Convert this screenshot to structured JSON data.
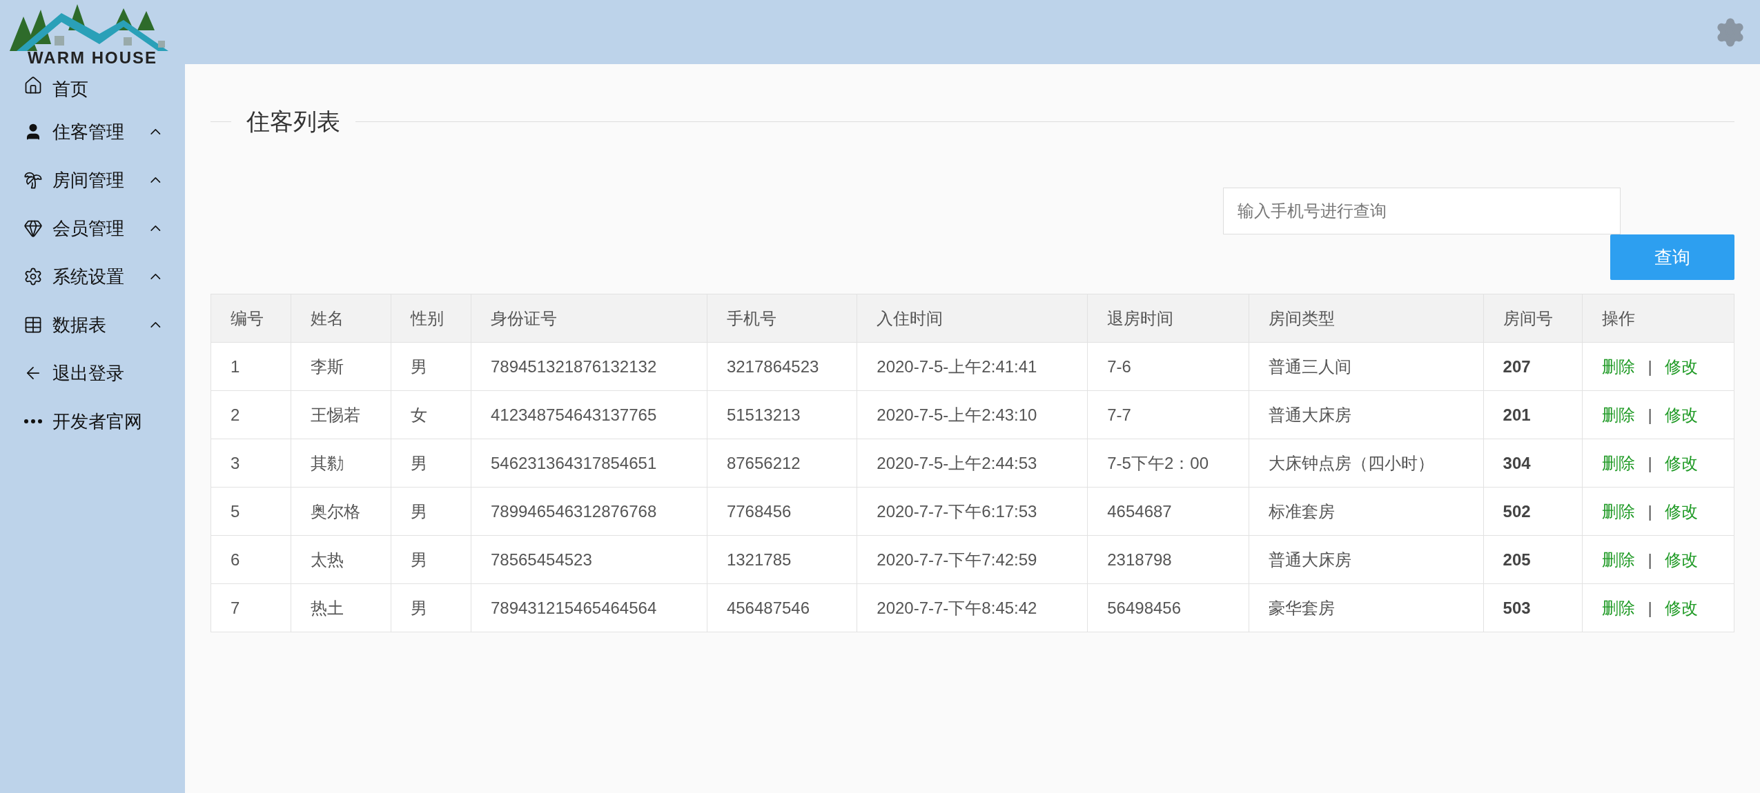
{
  "logo": {
    "text": "WARM HOUSE"
  },
  "sidebar": {
    "items": [
      {
        "label": "首页",
        "kind": "link"
      },
      {
        "label": "住客管理",
        "kind": "submenu"
      },
      {
        "label": "房间管理",
        "kind": "submenu"
      },
      {
        "label": "会员管理",
        "kind": "submenu"
      },
      {
        "label": "系统设置",
        "kind": "submenu"
      },
      {
        "label": "数据表",
        "kind": "submenu"
      },
      {
        "label": "退出登录",
        "kind": "link"
      },
      {
        "label": "开发者官网",
        "kind": "link"
      }
    ]
  },
  "page_title": "住客列表",
  "search": {
    "placeholder": "输入手机号进行查询"
  },
  "search_button": "查询",
  "table": {
    "columns": [
      "编号",
      "姓名",
      "性别",
      "身份证号",
      "手机号",
      "入住时间",
      "退房时间",
      "房间类型",
      "房间号",
      "操作"
    ],
    "rows": [
      {
        "cells": [
          "1",
          "李斯",
          "男",
          "789451321876132132",
          "3217864523",
          "2020-7-5-上午2:41:41",
          "7-6",
          "普通三人间",
          "207"
        ],
        "actions": {
          "delete": "删除",
          "separator": "|",
          "edit": "修改"
        }
      },
      {
        "cells": [
          "2",
          "王惕若",
          "女",
          "412348754643137765",
          "51513213",
          "2020-7-5-上午2:43:10",
          "7-7",
          "普通大床房",
          "201"
        ],
        "actions": {
          "delete": "删除",
          "separator": "|",
          "edit": "修改"
        }
      },
      {
        "cells": [
          "3",
          "其勬",
          "男",
          "546231364317854651",
          "87656212",
          "2020-7-5-上午2:44:53",
          "7-5下午2：00",
          "大床钟点房（四小时）",
          "304"
        ],
        "actions": {
          "delete": "删除",
          "separator": "|",
          "edit": "修改"
        }
      },
      {
        "cells": [
          "5",
          "奥尔格",
          "男",
          "789946546312876768",
          "7768456",
          "2020-7-7-下午6:17:53",
          "4654687",
          "标准套房",
          "502"
        ],
        "actions": {
          "delete": "删除",
          "separator": "|",
          "edit": "修改"
        }
      },
      {
        "cells": [
          "6",
          "太热",
          "男",
          "78565454523",
          "1321785",
          "2020-7-7-下午7:42:59",
          "2318798",
          "普通大床房",
          "205"
        ],
        "actions": {
          "delete": "删除",
          "separator": "|",
          "edit": "修改"
        }
      },
      {
        "cells": [
          "7",
          "热土",
          "男",
          "789431215465464564",
          "456487546",
          "2020-7-7-下午8:45:42",
          "56498456",
          "豪华套房",
          "503"
        ],
        "actions": {
          "delete": "删除",
          "separator": "|",
          "edit": "修改"
        }
      }
    ]
  }
}
